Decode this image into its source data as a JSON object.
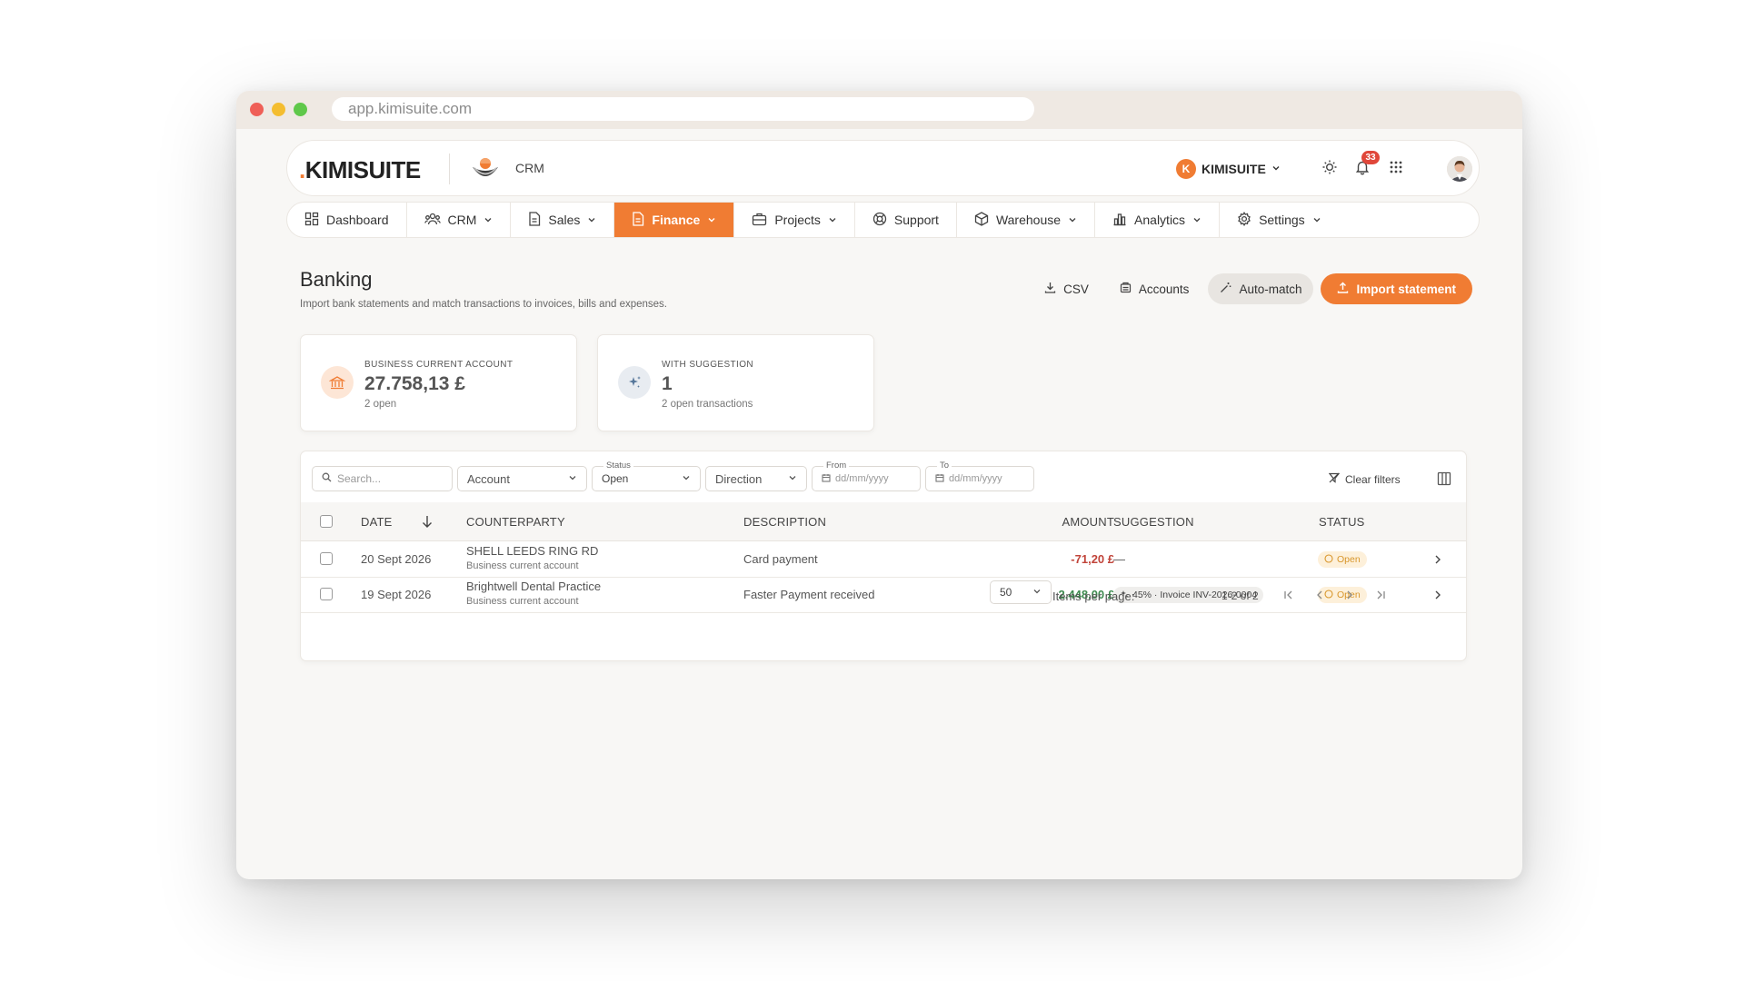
{
  "browser": {
    "url": "app.kimisuite.com"
  },
  "header": {
    "logo_dot": ".",
    "logo_text": "KIMISUITE",
    "app_name": "CRM",
    "tenant_initial": "K",
    "tenant_name": "KIMISUITE",
    "notifications_count": "33"
  },
  "nav": {
    "items": [
      {
        "label": "Dashboard",
        "icon": "dashboard-icon"
      },
      {
        "label": "CRM",
        "icon": "users-icon"
      },
      {
        "label": "Sales",
        "icon": "document-icon"
      },
      {
        "label": "Finance",
        "icon": "document-icon",
        "active": true
      },
      {
        "label": "Projects",
        "icon": "briefcase-icon"
      },
      {
        "label": "Support",
        "icon": "lifebuoy-icon"
      },
      {
        "label": "Warehouse",
        "icon": "box-icon"
      },
      {
        "label": "Analytics",
        "icon": "bar-chart-icon"
      },
      {
        "label": "Settings",
        "icon": "gear-icon"
      }
    ]
  },
  "page": {
    "title": "Banking",
    "subtitle": "Import bank statements and match transactions to invoices, bills and expenses."
  },
  "actions": {
    "csv": "CSV",
    "accounts": "Accounts",
    "auto_match": "Auto-match",
    "import": "Import statement"
  },
  "cards": [
    {
      "label": "BUSINESS CURRENT ACCOUNT",
      "value": "27.758,13 £",
      "sub": "2 open"
    },
    {
      "label": "WITH SUGGESTION",
      "value": "1",
      "sub": "2 open transactions"
    }
  ],
  "filters": {
    "search_placeholder": "Search...",
    "account": "Account",
    "status_label": "Status",
    "status_value": "Open",
    "direction": "Direction",
    "from_label": "From",
    "from_placeholder": "dd/mm/yyyy",
    "to_label": "To",
    "to_placeholder": "dd/mm/yyyy",
    "clear": "Clear filters"
  },
  "table": {
    "columns": {
      "date": "DATE",
      "counterparty": "COUNTERPARTY",
      "description": "DESCRIPTION",
      "amount": "AMOUNT",
      "suggestion": "SUGGESTION",
      "status": "STATUS"
    },
    "rows": [
      {
        "date": "20 Sept 2026",
        "counterparty": "SHELL LEEDS RING RD",
        "account": "Business current account",
        "description": "Card payment",
        "amount": "-71,20 £",
        "suggestion": "—",
        "status": "Open"
      },
      {
        "date": "19 Sept 2026",
        "counterparty": "Brightwell Dental Practice",
        "account": "Business current account",
        "description": "Faster Payment received",
        "amount": "2.448,00 £",
        "suggestion": "45% · Invoice INV-2026-0004",
        "status": "Open"
      }
    ]
  },
  "pagination": {
    "items_per_page_label": "Items per page:",
    "items_per_page": "50",
    "range": "1-2 of 2"
  },
  "colors": {
    "accent": "#f07c33",
    "negative": "#c1443a",
    "positive": "#3d8a4f",
    "status_open": "#d8962b"
  }
}
